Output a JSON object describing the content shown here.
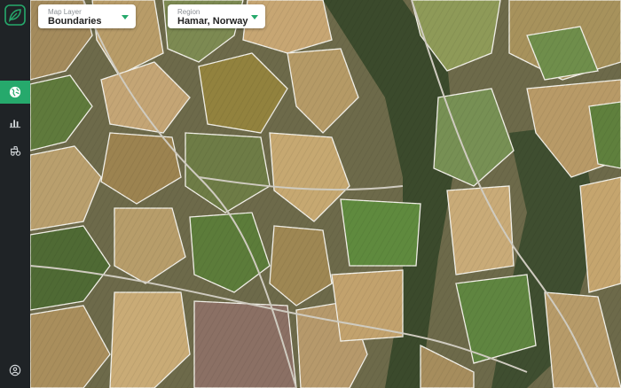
{
  "colors": {
    "accent": "#26a96c",
    "sidebar": "#1f2326"
  },
  "sidebar": {
    "items": [
      {
        "icon": "globe-icon",
        "active": true
      },
      {
        "icon": "bar-chart-icon",
        "active": false
      },
      {
        "icon": "tractor-icon",
        "active": false
      }
    ],
    "bottom_icon": "user-icon"
  },
  "controls": {
    "map_layer": {
      "label": "Map Layer",
      "value": "Boundaries"
    },
    "region": {
      "label": "Region",
      "value": "Hamar, Norway"
    }
  }
}
